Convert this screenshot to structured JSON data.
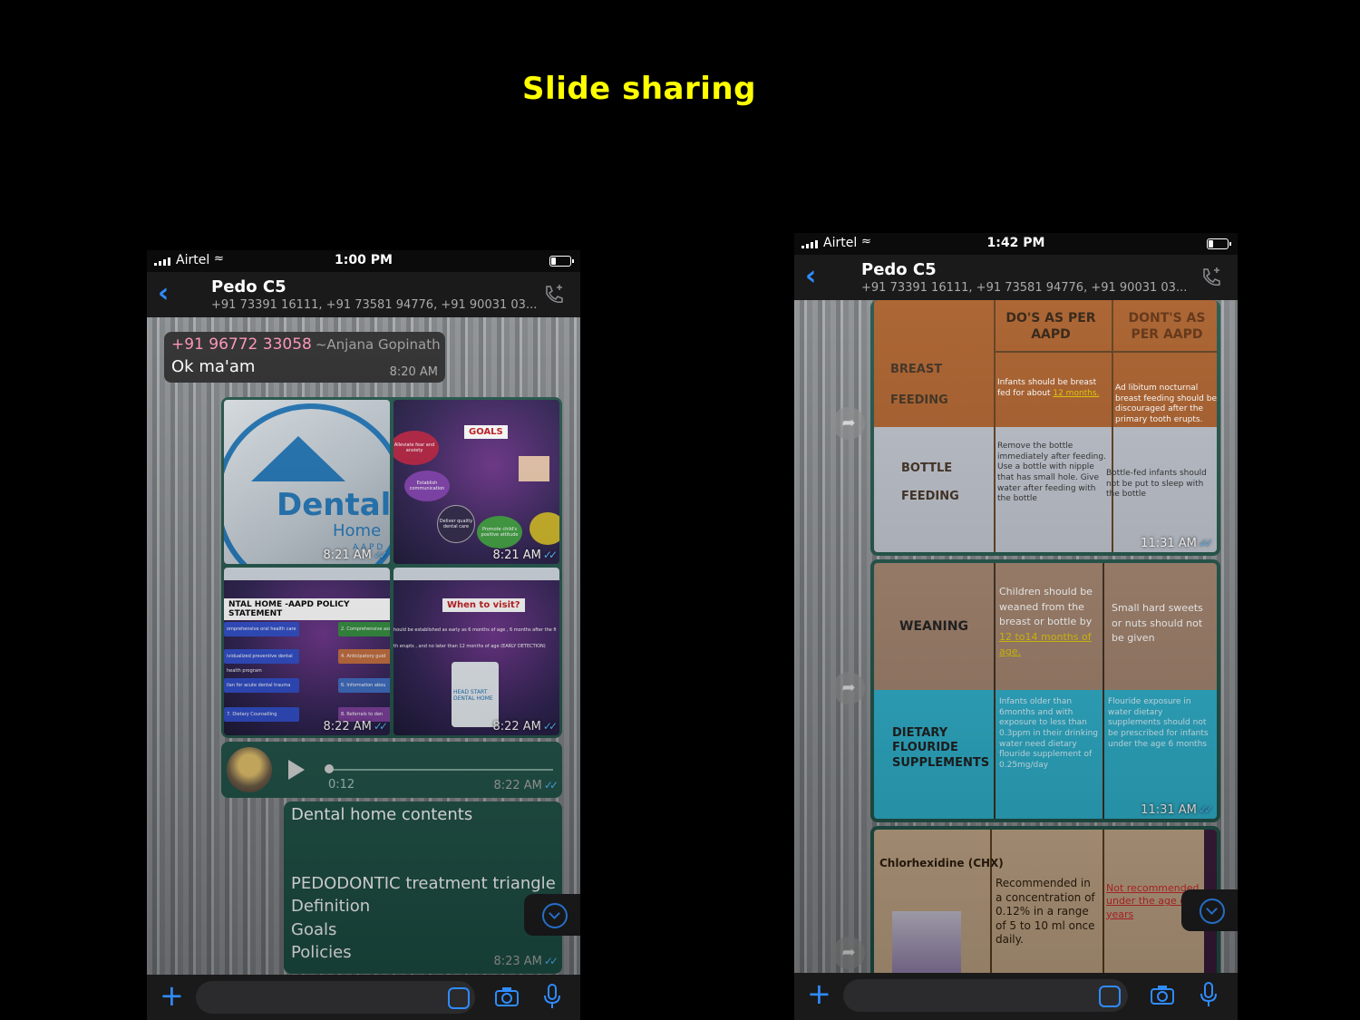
{
  "page": {
    "title": "Slide sharing"
  },
  "left_phone": {
    "status": {
      "carrier": "Airtel",
      "time": "1:00 PM"
    },
    "header": {
      "title": "Pedo C5",
      "subtitle": "+91 73391 16111, +91 73581 94776, +91 90031 03..."
    },
    "messages": {
      "incoming": {
        "sender_number": "+91 96772 33058",
        "sender_name": "~Anjana Gopinath",
        "text": "Ok ma'am",
        "time": "8:20 AM"
      },
      "images": [
        {
          "time": "8:21 AM",
          "logo_text": "Dental",
          "logo_sub": "Home",
          "logo_small": "A A P D"
        },
        {
          "time": "8:21 AM",
          "title": "GOALS",
          "items": [
            "Alleviate fear and anxiety",
            "Establish communication",
            "Deliver quality dental care",
            "Promote child's positive attitude"
          ]
        },
        {
          "time": "8:22 AM",
          "title": "NTAL HOME -AAPD POLICY STATEMENT",
          "items": [
            "omprehensive oral health care",
            "ividualized preventive dental health program",
            "ilan for acute dental trauma",
            "7. Dietary Counselling",
            "2. Comprehensive ass",
            "4. Anticipatory guid",
            "6. Information abou",
            "8. Referrals to den"
          ]
        },
        {
          "time": "8:22 AM",
          "title": "When to visit?",
          "line1": "hould be established as early as 6 months of age , 6 months after the fi",
          "line2": "th erupts , and no later than 12 months of age  (EARLY DETECTION)",
          "badge": "HEAD START DENTAL HOME"
        }
      ],
      "audio": {
        "duration": "0:12",
        "time": "8:22 AM"
      },
      "text_message": {
        "lines": [
          "Dental home contents",
          "",
          "",
          "PEDODONTIC treatment triangle",
          "Definition",
          "Goals",
          "Policies"
        ],
        "time": "8:23 AM"
      }
    },
    "icons": {
      "back": "chevron-left-icon",
      "call": "add-call-icon",
      "plus": "plus-icon",
      "sticker": "sticker-icon",
      "camera": "camera-icon",
      "mic": "microphone-icon",
      "scroll": "scroll-down-icon"
    }
  },
  "right_phone": {
    "status": {
      "carrier": "Airtel",
      "time": "1:42 PM"
    },
    "header": {
      "title": "Pedo C5",
      "subtitle": "+91 73391 16111, +91 73581 94776, +91 90031 03..."
    },
    "messages": [
      {
        "time": "11:31 AM",
        "headers": [
          "DO'S AS PER AAPD",
          "DONT'S AS PER AAPD"
        ],
        "rows": [
          {
            "label": "BREAST FEEDING",
            "dos": "Infants should be breast fed for about",
            "dos_hl": "12 months.",
            "donts": "Ad libitum nocturnal breast feeding should be discouraged after the primary tooth erupts."
          },
          {
            "label": "BOTTLE FEEDING",
            "dos": "Remove the bottle immediately after feeding. Use a bottle with nipple that has small hole. Give water after feeding with the bottle",
            "donts": "Bottle-fed infants should not be put to sleep with the bottle"
          }
        ]
      },
      {
        "time": "11:31 AM",
        "rows": [
          {
            "label": "WEANING",
            "dos": "Children should be weaned from the breast or bottle by",
            "dos_hl": "12 to14 months of age.",
            "donts": "Small hard sweets or nuts should not be given"
          },
          {
            "label": "DIETARY FLOURIDE SUPPLEMENTS",
            "dos": "Infants older than 6months and with exposure to less than 0.3ppm in their drinking water need dietary flouride supplement of 0.25mg/day",
            "donts": "Flouride exposure in water dietary supplements should not be prescribed for infants under the age 6 months"
          }
        ]
      },
      {
        "rows": [
          {
            "label": "Chlorhexidine (CHX)",
            "dos": "Recommended in a concentration of 0.12% in a range of 5 to 10 ml once daily.",
            "donts": "Not recommended under the age of",
            "donts_tail": "years"
          }
        ]
      }
    ]
  },
  "colors": {
    "title": "#ffff00",
    "bubble_out": "#1d5146",
    "bubble_in": "#262626",
    "accent": "#2f8cff",
    "ticks": "#4fb7ff",
    "sender": "#ff8fb6"
  }
}
